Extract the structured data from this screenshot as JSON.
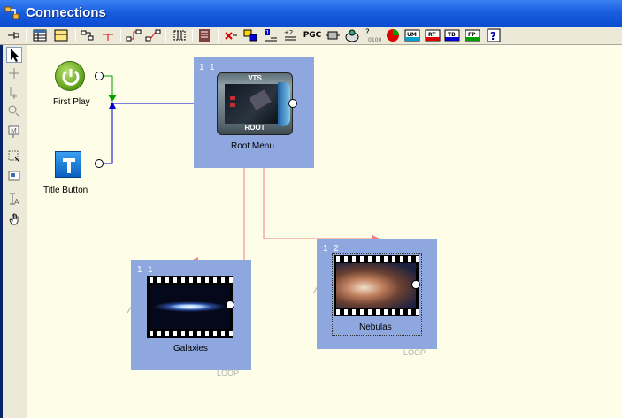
{
  "window": {
    "title": "Connections"
  },
  "toolbar": {
    "pgc_label": "PGC",
    "buttons": [
      "pin-icon",
      "grid-icon",
      "layout-icon",
      "connect-icon",
      "disconnect-icon",
      "link-icon",
      "unlink-icon",
      "frame-icon",
      "stack-icon",
      "delete-icon",
      "color-icon",
      "number-icon",
      "renumber-icon",
      "pgc-button",
      "sequence-icon",
      "disc-icon",
      "unknown-icon",
      "chart-icon",
      "um-icon",
      "rt-icon",
      "tb-icon",
      "fp-icon",
      "help-icon"
    ],
    "badges": {
      "um": "UM",
      "rt": "RT",
      "tb": "TB",
      "fp": "FP",
      "counter": "0100"
    }
  },
  "nodes": {
    "first_play": {
      "label": "First Play"
    },
    "title_button": {
      "label": "Title Button"
    },
    "root_menu": {
      "label": "Root Menu",
      "num1": "1",
      "num2": "1",
      "vts": "VTS",
      "root": "ROOT"
    },
    "galaxies": {
      "label": "Galaxies",
      "num1": "1",
      "num2": "1",
      "loop": "LOOP"
    },
    "nebulas": {
      "label": "Nebulas",
      "num1": "1",
      "num2": "2",
      "loop": "LOOP"
    }
  },
  "colors": {
    "title_bar": "#0b4bd0",
    "panel": "#8ea8df",
    "connector_blue": "#0000d0",
    "connector_green": "#00a000",
    "connector_red": "#f08080",
    "canvas": "#fdfde8"
  }
}
